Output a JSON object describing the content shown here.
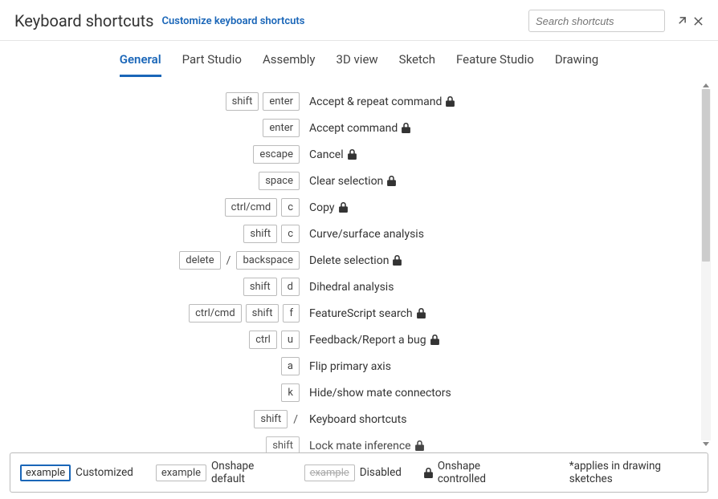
{
  "header": {
    "title": "Keyboard shortcuts",
    "customize_link": "Customize keyboard shortcuts",
    "search_placeholder": "Search shortcuts"
  },
  "tabs": [
    {
      "label": "General",
      "active": true
    },
    {
      "label": "Part Studio",
      "active": false
    },
    {
      "label": "Assembly",
      "active": false
    },
    {
      "label": "3D view",
      "active": false
    },
    {
      "label": "Sketch",
      "active": false
    },
    {
      "label": "Feature Studio",
      "active": false
    },
    {
      "label": "Drawing",
      "active": false
    }
  ],
  "shortcuts": [
    {
      "keys": [
        "shift",
        "enter"
      ],
      "desc": "Accept & repeat command",
      "locked": true
    },
    {
      "keys": [
        "enter"
      ],
      "desc": "Accept command",
      "locked": true
    },
    {
      "keys": [
        "escape"
      ],
      "desc": "Cancel",
      "locked": true
    },
    {
      "keys": [
        "space"
      ],
      "desc": "Clear selection",
      "locked": true
    },
    {
      "keys": [
        "ctrl/cmd",
        "c"
      ],
      "desc": "Copy",
      "locked": true
    },
    {
      "keys": [
        "shift",
        "c"
      ],
      "desc": "Curve/surface analysis",
      "locked": false
    },
    {
      "keys": [
        "delete",
        "/",
        "backspace"
      ],
      "desc": "Delete selection",
      "locked": true
    },
    {
      "keys": [
        "shift",
        "d"
      ],
      "desc": "Dihedral analysis",
      "locked": false
    },
    {
      "keys": [
        "ctrl/cmd",
        "shift",
        "f"
      ],
      "desc": "FeatureScript search",
      "locked": true
    },
    {
      "keys": [
        "ctrl",
        "u"
      ],
      "desc": "Feedback/Report a bug",
      "locked": true
    },
    {
      "keys": [
        "a"
      ],
      "desc": "Flip primary axis",
      "locked": false
    },
    {
      "keys": [
        "k"
      ],
      "desc": "Hide/show mate connectors",
      "locked": false
    },
    {
      "keys": [
        "shift",
        "/"
      ],
      "desc": "Keyboard shortcuts",
      "locked": false
    },
    {
      "keys": [
        "shift"
      ],
      "desc": "Lock mate inference",
      "locked": true,
      "partial": true
    }
  ],
  "legend": {
    "example_text": "example",
    "customized": "Customized",
    "default": "Onshape default",
    "disabled": "Disabled",
    "controlled": "Onshape controlled",
    "applies": "*applies in drawing sketches"
  }
}
